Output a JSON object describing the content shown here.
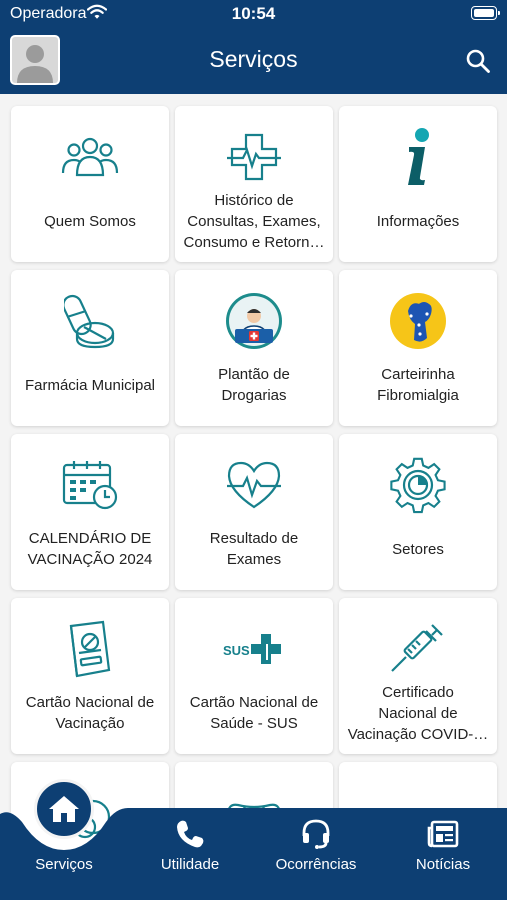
{
  "status_bar": {
    "carrier": "Operadora",
    "time": "10:54"
  },
  "header": {
    "title": "Serviços"
  },
  "services": [
    {
      "label": "Quem Somos",
      "icon": "people-group-icon"
    },
    {
      "label": "Histórico de\nConsultas, Exames,\nConsumo e Retorn…",
      "icon": "medical-cross-pulse-icon"
    },
    {
      "label": "Informações",
      "icon": "info-icon"
    },
    {
      "label": "Farmácia Municipal",
      "icon": "pills-icon"
    },
    {
      "label": "Plantão de\nDrogarias",
      "icon": "pharmacist-icon"
    },
    {
      "label": "Carteirinha\nFibromialgia",
      "icon": "fibromyalgia-icon"
    },
    {
      "label": "CALENDÁRIO DE\nVACINAÇÃO 2024",
      "icon": "calendar-clock-icon"
    },
    {
      "label": "Resultado de\nExames",
      "icon": "heart-pulse-icon"
    },
    {
      "label": "Setores",
      "icon": "gear-chart-icon"
    },
    {
      "label": "Cartão Nacional de\nVacinação",
      "icon": "vaccination-card-icon"
    },
    {
      "label": "Cartão Nacional de\nSaúde - SUS",
      "icon": "sus-logo-icon",
      "logo_text": "SUS"
    },
    {
      "label": "Certificado\nNacional de\nVacinação COVID-…",
      "icon": "syringe-icon"
    }
  ],
  "bottom_nav": [
    {
      "label": "Serviços",
      "icon": "home-icon"
    },
    {
      "label": "Utilidade",
      "icon": "phone-icon"
    },
    {
      "label": "Ocorrências",
      "icon": "headset-icon"
    },
    {
      "label": "Notícias",
      "icon": "newspaper-icon"
    }
  ],
  "colors": {
    "primary": "#0d3f73",
    "icon_teal": "#17808c",
    "background": "#f4f4f4"
  }
}
